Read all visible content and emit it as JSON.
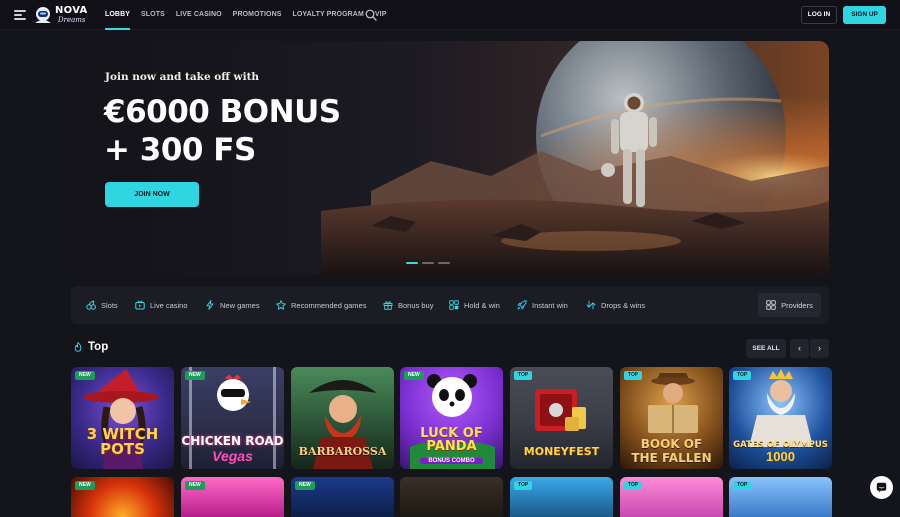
{
  "header": {
    "logo_line1": "NOVA",
    "logo_line2": "Dreams",
    "nav": [
      "LOBBY",
      "SLOTS",
      "LIVE CASINO",
      "PROMOTIONS",
      "LOYALTY PROGRAM",
      "VIP"
    ],
    "active_nav": "LOBBY",
    "login_label": "LOG IN",
    "signup_label": "SIGN UP"
  },
  "hero": {
    "subtitle": "Join now and take off with",
    "title_line1": "€6000 BONUS",
    "title_line2": "+ 300 FS",
    "cta_label": "JOIN NOW",
    "slides": 3,
    "active_slide": 1
  },
  "categories": {
    "items": [
      {
        "label": "Slots",
        "icon": "cherries-icon"
      },
      {
        "label": "Live casino",
        "icon": "live-tv-icon"
      },
      {
        "label": "New games",
        "icon": "lightning-icon"
      },
      {
        "label": "Recommended games",
        "icon": "star-icon"
      },
      {
        "label": "Bonus buy",
        "icon": "gift-icon"
      },
      {
        "label": "Hold & win",
        "icon": "hand-icon"
      },
      {
        "label": "Instant win",
        "icon": "rocket-icon"
      },
      {
        "label": "Drops & wins",
        "icon": "drops-icon"
      }
    ],
    "providers_label": "Providers"
  },
  "top_section": {
    "title": "Top",
    "see_all_label": "SEE ALL",
    "prev_icon": "‹",
    "next_icon": "›",
    "games": [
      {
        "name": "3 WITCH POTS",
        "badge": "NEW",
        "color": "#3a2a8a"
      },
      {
        "name": "CHICKEN ROAD",
        "sub": "Vegas",
        "badge": "NEW",
        "color": "#2c2f4a"
      },
      {
        "name": "BARBAROSSA",
        "badge": "",
        "color": "#2e5a3a"
      },
      {
        "name": "LUCK OF PANDA",
        "sub": "BONUS COMBO",
        "badge": "NEW",
        "color": "#7b2fd0"
      },
      {
        "name": "MONEYFEST",
        "badge": "TOP",
        "color": "#3a3d46"
      },
      {
        "name": "BOOK OF THE FALLEN",
        "badge": "TOP",
        "color": "#7a4a1a"
      },
      {
        "name": "GATES OF OLYMPUS",
        "sub": "1000",
        "badge": "TOP",
        "color": "#1d4f9a"
      }
    ],
    "row2_badges": [
      "NEW",
      "NEW",
      "NEW",
      "",
      "TOP",
      "TOP",
      "TOP"
    ]
  }
}
